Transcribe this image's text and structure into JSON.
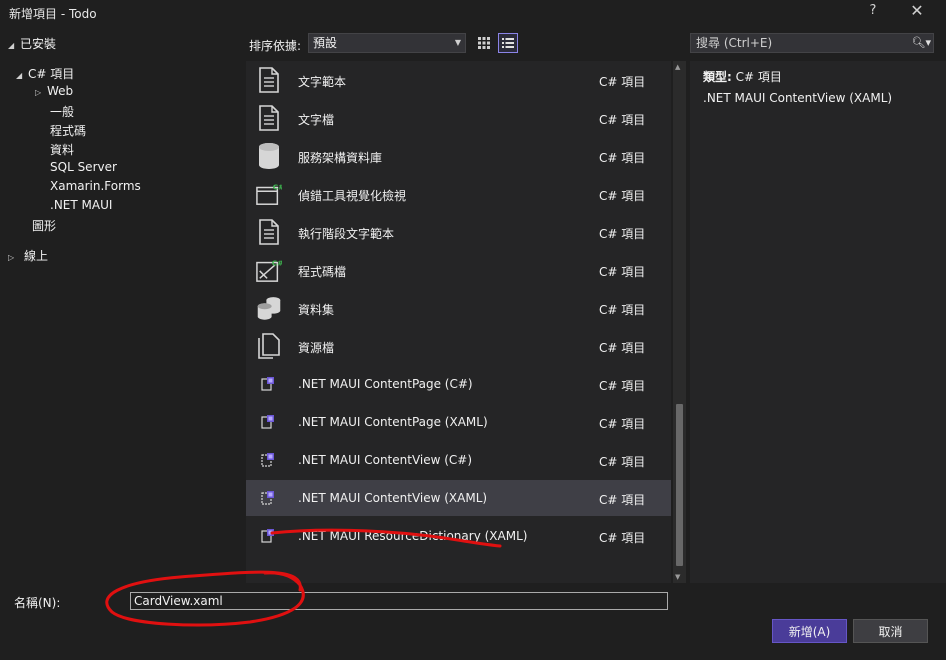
{
  "window": {
    "title": "新增項目 - Todo",
    "help_label": "?",
    "close_label": "✕"
  },
  "tree": {
    "installed_label": "已安裝",
    "csharp_items_label": "C# 項目",
    "children": [
      "Web",
      "一般",
      "程式碼",
      "資料",
      "SQL Server",
      "Xamarin.Forms",
      ".NET MAUI"
    ],
    "graphics_label": "圖形",
    "online_label": "線上"
  },
  "toolbar": {
    "sort_label": "排序依據:",
    "sort_value": "預設"
  },
  "search": {
    "placeholder": "搜尋 (Ctrl+E)"
  },
  "templates": [
    {
      "name": "文字範本",
      "type": "C# 項目",
      "icon": "text-template-icon"
    },
    {
      "name": "文字檔",
      "type": "C# 項目",
      "icon": "text-file-icon"
    },
    {
      "name": "服務架構資料庫",
      "type": "C# 項目",
      "icon": "database-icon"
    },
    {
      "name": "偵錯工具視覺化檢視",
      "type": "C# 項目",
      "icon": "debugger-visualizer-icon"
    },
    {
      "name": "執行階段文字範本",
      "type": "C# 項目",
      "icon": "runtime-text-template-icon"
    },
    {
      "name": "程式碼檔",
      "type": "C# 項目",
      "icon": "code-file-icon"
    },
    {
      "name": "資料集",
      "type": "C# 項目",
      "icon": "dataset-icon"
    },
    {
      "name": "資源檔",
      "type": "C# 項目",
      "icon": "resource-file-icon"
    },
    {
      "name": ".NET MAUI ContentPage (C#)",
      "type": "C# 項目",
      "icon": "maui-page-icon"
    },
    {
      "name": ".NET MAUI ContentPage (XAML)",
      "type": "C# 項目",
      "icon": "maui-page-icon"
    },
    {
      "name": ".NET MAUI ContentView (C#)",
      "type": "C# 項目",
      "icon": "maui-view-icon"
    },
    {
      "name": ".NET MAUI ContentView (XAML)",
      "type": "C# 項目",
      "icon": "maui-view-icon",
      "selected": true
    },
    {
      "name": ".NET MAUI ResourceDictionary (XAML)",
      "type": "C# 項目",
      "icon": "maui-resource-icon"
    }
  ],
  "details": {
    "type_label": "類型:",
    "type_value": "C# 項目",
    "description": ".NET MAUI ContentView (XAML)"
  },
  "name_field": {
    "label": "名稱(N):",
    "value": "CardView.xaml"
  },
  "buttons": {
    "add": "新增(A)",
    "cancel": "取消"
  },
  "colors": {
    "accent": "#4a3c99",
    "selected_row": "#3f3f46",
    "annotation": "#e01010"
  }
}
